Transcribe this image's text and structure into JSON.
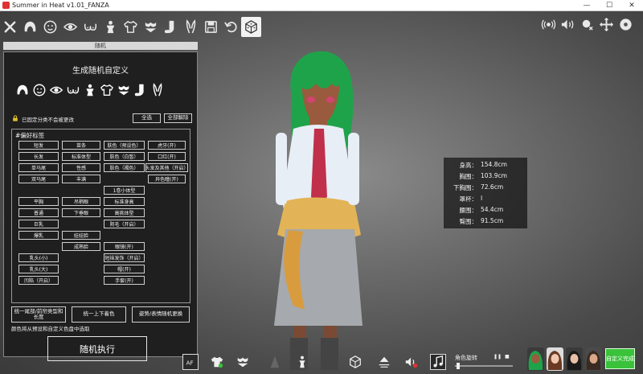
{
  "window": {
    "title": "Summer in Heat v1.01_FANZA",
    "controls": [
      "—",
      "☐",
      "✕"
    ]
  },
  "toolbar": {
    "left_icons": [
      "close-icon",
      "hair-icon",
      "face-icon",
      "eye-icon",
      "chest-icon",
      "body-icon",
      "shirt-icon",
      "underwear-icon",
      "sock-icon",
      "bunny-ears-icon",
      "save-icon",
      "undo-icon",
      "dice-icon"
    ],
    "active_icon": "dice-icon",
    "right_icons": [
      "voice-icon",
      "sound-icon",
      "light-icon",
      "move-icon",
      "settings-icon"
    ]
  },
  "panel": {
    "title": "随机",
    "heading": "生成随机自定义",
    "category_icons": [
      "hair-icon",
      "face-icon",
      "eye-icon",
      "chest-icon",
      "body-icon",
      "shirt-icon",
      "underwear-icon",
      "sock-icon",
      "bunny-ears-icon"
    ],
    "lock_text": "已固定分类不会被更改",
    "select_all": "全选",
    "clear_all": "全部解除",
    "tags_heading": "#偏好标签",
    "tags": {
      "short_hair": "短发",
      "long_hair": "长发",
      "ponytail": "单马尾",
      "twintail": "双马尾",
      "slim": "苗条",
      "standard_body": "标准体型",
      "sexy": "性感",
      "plump": "丰满",
      "skin_preset": "肤色（预设色）",
      "skin_white": "肤色（白皙）",
      "skin_tan": "肤色（褐色）",
      "fang": "虎牙(开)",
      "mole": "口红(开)",
      "hair_accessory": "头发及其他（开启）",
      "heterochromia": "异色瞳(开)",
      "short_stature": "1卷小体型",
      "flat_chest": "平胸",
      "normal_chest": "普通",
      "big_chest": "巨乳",
      "huge_chest": "爆乳",
      "droopy_eyes": "吊梢眼",
      "lower_eyes": "下垂眼",
      "loli": "娃娃脸",
      "mature": "成熟脸",
      "standard_height": "标准身高",
      "tall": "高挑体型",
      "tan_lines": "阴毛（开启）",
      "gloves": "眼镜(开)",
      "nipple_small": "乳头(小)",
      "nipple_large": "乳头(大)",
      "inverted": "凹陷（开启）",
      "hair_tie": "短袜发饰（开启）",
      "hat": "帽(开)",
      "mittens": "手套(开)"
    },
    "unify_tails": "统一尾部/前帘类型和长度",
    "unify_color": "统一上下着色",
    "pose_change": "姿势/表情随机更换",
    "note": "颜色将从预设和自定义色盘中选取",
    "execute": "随机执行"
  },
  "measurements": [
    {
      "label": "身高：",
      "value": "154.8cm"
    },
    {
      "label": "胸围：",
      "value": "103.9cm"
    },
    {
      "label": "下胸围：",
      "value": "72.6cm"
    },
    {
      "label": "罩杯：",
      "value": "I"
    },
    {
      "label": "腰围：",
      "value": "54.4cm"
    },
    {
      "label": "臀围：",
      "value": "91.5cm"
    }
  ],
  "bottom": {
    "icons": [
      "af-icon",
      "top-clothing-icon",
      "underwear-icon",
      "shadow-icon",
      "pose-icon",
      "cube-icon",
      "light-cone-icon",
      "speaker-icon",
      "music-icon"
    ],
    "rotation_label": "角色旋转",
    "pause": "❚❚",
    "stop": "■",
    "complete": "自定义完成"
  },
  "colors": {
    "accent_green": "#39c23a",
    "hair_green": "#1fa34a",
    "skin": "#9a5a3e",
    "skirt": "#a6a9ad",
    "sweater": "#e2b457"
  }
}
